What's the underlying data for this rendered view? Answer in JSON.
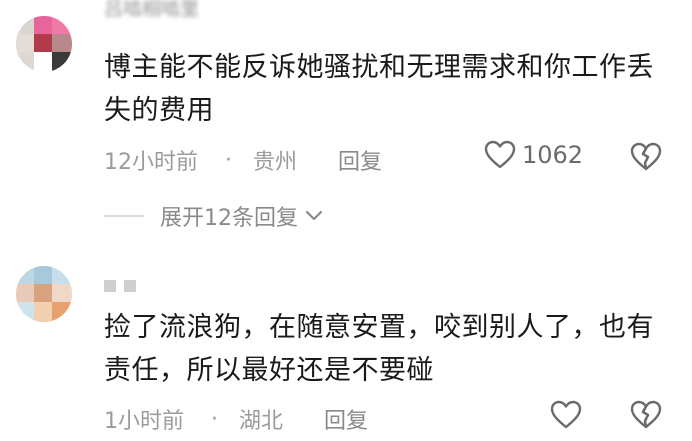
{
  "comments": [
    {
      "username": "吕啮相啮里",
      "text": "博主能不能反诉她骚扰和无理需求和你工作丢失的费用",
      "time": "12小时前",
      "location": "贵州",
      "reply_label": "回复",
      "likes": "1062",
      "expand_label": "展开12条回复"
    },
    {
      "text": "捡了流浪狗，在随意安置，咬到别人了，也有责任，所以最好还是不要碰",
      "time": "1小时前",
      "location": "湖北",
      "reply_label": "回复"
    }
  ],
  "separator": "·",
  "icons": [
    "like-heart-icon",
    "dislike-broken-heart-icon",
    "chevron-down-icon"
  ],
  "colors": {
    "meta": "#9b9b9b",
    "text": "#1a1a1a",
    "icon": "#6b6b6b"
  }
}
